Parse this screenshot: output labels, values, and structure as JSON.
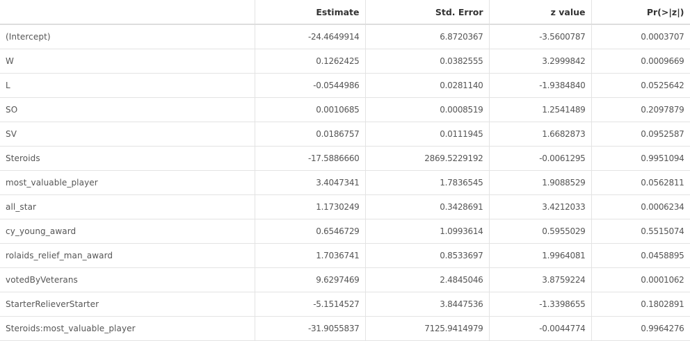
{
  "table": {
    "columns": [
      "",
      "Estimate",
      "Std. Error",
      "z value",
      "Pr(>|z|)"
    ],
    "rows": [
      [
        "(Intercept)",
        "-24.4649914",
        "6.8720367",
        "-3.5600787",
        "0.0003707"
      ],
      [
        "W",
        "0.1262425",
        "0.0382555",
        "3.2999842",
        "0.0009669"
      ],
      [
        "L",
        "-0.0544986",
        "0.0281140",
        "-1.9384840",
        "0.0525642"
      ],
      [
        "SO",
        "0.0010685",
        "0.0008519",
        "1.2541489",
        "0.2097879"
      ],
      [
        "SV",
        "0.0186757",
        "0.0111945",
        "1.6682873",
        "0.0952587"
      ],
      [
        "Steroids",
        "-17.5886660",
        "2869.5229192",
        "-0.0061295",
        "0.9951094"
      ],
      [
        "most_valuable_player",
        "3.4047341",
        "1.7836545",
        "1.9088529",
        "0.0562811"
      ],
      [
        "all_star",
        "1.1730249",
        "0.3428691",
        "3.4212033",
        "0.0006234"
      ],
      [
        "cy_young_award",
        "0.6546729",
        "1.0993614",
        "0.5955029",
        "0.5515074"
      ],
      [
        "rolaids_relief_man_award",
        "1.7036741",
        "0.8533697",
        "1.9964081",
        "0.0458895"
      ],
      [
        "votedByVeterans",
        "9.6297469",
        "2.4845046",
        "3.8759224",
        "0.0001062"
      ],
      [
        "StarterRelieverStarter",
        "-5.1514527",
        "3.8447536",
        "-1.3398655",
        "0.1802891"
      ],
      [
        "Steroids:most_valuable_player",
        "-31.9055837",
        "7125.9414979",
        "-0.0044774",
        "0.9964276"
      ]
    ]
  }
}
